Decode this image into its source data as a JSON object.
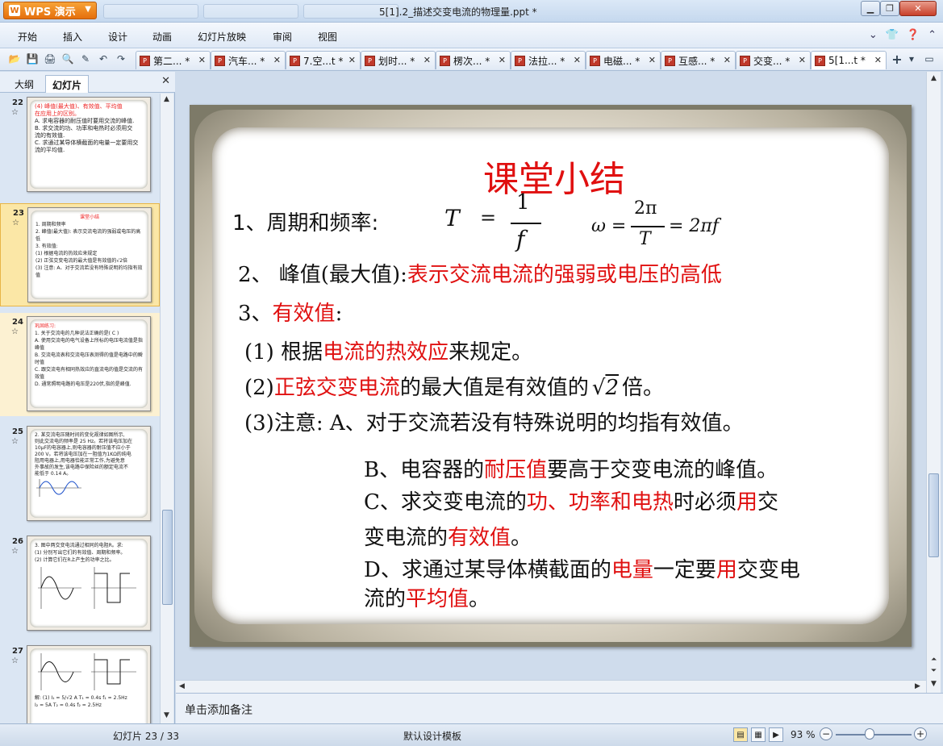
{
  "app": {
    "name": "WPS 演示",
    "window_title": "5[1].2_描述交变电流的物理量.ppt *"
  },
  "menu": [
    "开始",
    "插入",
    "设计",
    "动画",
    "幻灯片放映",
    "审阅",
    "视图"
  ],
  "doc_tabs": [
    "第二... *",
    "汽车... *",
    "7.空...t *",
    "划时... *",
    "楞次... *",
    "法拉... *",
    "电磁... *",
    "互感... *",
    "交变... *",
    "5[1...t *"
  ],
  "left_panel": {
    "tabs": [
      "大纲",
      "幻灯片"
    ],
    "thumbnails": [
      {
        "num": "22",
        "lines": [
          "(4) 峰值(最大值)、有效值、平均值",
          "在应用上的区别。",
          "A. 求电容器的耐压值时要用交流的峰值.",
          "B. 求交流的功、功率和电热时必须用交",
          "流的有效值.",
          "C. 求通过某导体横截面的电量一定要用交",
          "流的平均值."
        ]
      },
      {
        "num": "23",
        "lines": [
          "课堂小结",
          "1. 周期和频率",
          "2. 峰值(最大值): 表示交流电流的强弱或电压的高低",
          "3. 有效值:",
          "(1) 根据电流的热效应来规定",
          "(2) 正弦交变电流的最大值是有效值的√2倍",
          "(3) 注意: A、对于交流若没有特殊说明的均指有效值"
        ]
      },
      {
        "num": "24",
        "lines": [
          "巩固练习:",
          "1. 关于交流电的几种说法正确的是( C )",
          "A. 使用交流电的电气设备上所标的电压电流值是指峰值",
          "B. 交流电流表和交流电压表测得的值是电路中的瞬时值",
          "C. 跟交流电有相同热效应的直流电的值是交流的有效值",
          "D. 通常照明电路的电压是220伏,指的是峰值."
        ]
      },
      {
        "num": "25",
        "lines": [
          "2. 某交流电压随时间的变化规律如图所示,",
          "则此交流电的频率是 25 Hz。若将该电压加在",
          "10μF的电容器上,则电容器的耐压值不应小于",
          "200 V。若将该电压加在一阻值为1KΩ的纯电",
          "阻用电器上,用电器恰能正常工作,为避免意",
          "外事故的发生,该电路中保险丝的额定电流不",
          "能低于 0.14 A。"
        ]
      },
      {
        "num": "26",
        "lines": [
          "3. 图中两交变电流通过相同的电阻R。求:",
          "(1) 分别写出它们的有效值、周期和频率。",
          "(2) 计算它们在R上产生的功率之比。"
        ]
      },
      {
        "num": "27",
        "lines": [
          "解: (1) I₁ = 5/√2 A   T₁ = 0.4s   f₁ = 2.5Hz",
          "I₂ = 5A   T₂ = 0.4s   f₂ = 2.5Hz"
        ]
      }
    ]
  },
  "slide": {
    "title": "课堂小结",
    "item1_label": "1、周期和频率:",
    "formula_T": "T",
    "formula_eq": "=",
    "formula_num": "1",
    "formula_den": "f",
    "formula_omega": "ω =",
    "formula_2pi": "2π",
    "formula_T2": "T",
    "formula_rhs": "= 2πf",
    "item2_prefix": "2、 峰值(最大值):",
    "item2_red": "表示交流电流的强弱或电压的高低",
    "item3_prefix": "3、",
    "item3_red": "有效值",
    "item3_suffix": ":",
    "sub1_prefix": "(1) 根据",
    "sub1_red": "电流的热效应",
    "sub1_suffix": "来规定。",
    "sub2_prefix": "(2)",
    "sub2_red": "正弦交变电流",
    "sub2_mid": "的最大值是有效值的",
    "sub2_sqrt": "2",
    "sub2_suffix": "倍。",
    "sub3": "(3)注意: A、对于交流若没有特殊说明的均指有效值。",
    "B_prefix": "B、电容器的",
    "B_red": "耐压值",
    "B_suffix": "要高于交变电流的峰值。",
    "C_prefix": "C、求交变电流的",
    "C_red1": "功、功率和电热",
    "C_mid": "时必须",
    "C_red2": "用",
    "C_suffix": "交",
    "C2_prefix": "变电流的",
    "C2_red": "有效值",
    "C2_suffix": "。",
    "D_prefix": "D、求通过某导体横截面的",
    "D_red1": "电量",
    "D_mid": "一定要",
    "D_red2": "用",
    "D_suffix": "交变电",
    "D2_prefix": "流的",
    "D2_red": "平均值",
    "D2_suffix": "。"
  },
  "notes_placeholder": "单击添加备注",
  "status": {
    "slide_counter": "幻灯片 23 / 33",
    "template": "默认设计模板",
    "zoom": "93 %"
  }
}
